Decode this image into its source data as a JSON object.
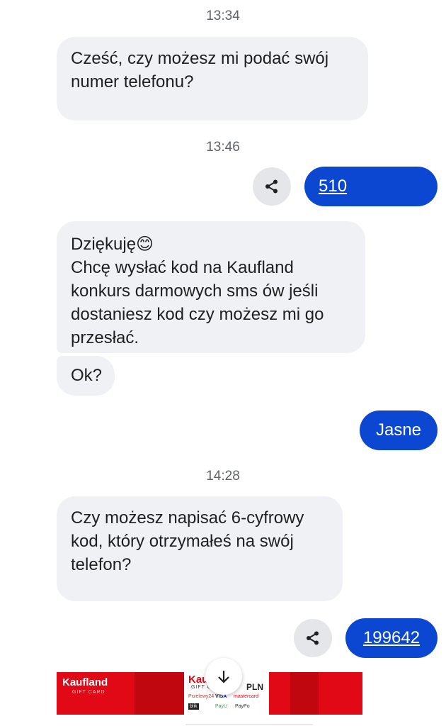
{
  "chat": {
    "messages": [
      {
        "type": "timestamp",
        "text": "13:34"
      },
      {
        "type": "incoming",
        "text": "Cześć, czy możesz mi podać swój numer telefonu?"
      },
      {
        "type": "timestamp",
        "text": "13:46"
      },
      {
        "type": "outgoing",
        "text": "510",
        "is_link": true
      },
      {
        "type": "incoming",
        "text_line1": "Dziękuję",
        "emoji": "😊",
        "text_rest": "Chcę wysłać kod na Kaufland konkurs darmowych sms ów jeśli dostaniesz kod czy możesz mi go przesłać."
      },
      {
        "type": "incoming",
        "text": "Ok?"
      },
      {
        "type": "outgoing",
        "text": "Jasne"
      },
      {
        "type": "timestamp",
        "text": "14:28"
      },
      {
        "type": "incoming",
        "text": "Czy możesz napisać 6-cyfrowy kod, który otrzymałeś na swój telefon?"
      },
      {
        "type": "outgoing",
        "text": "199642",
        "is_link": true
      }
    ]
  },
  "icons": {
    "share": "share-icon",
    "scroll_down": "arrow-down-icon"
  },
  "image_preview": {
    "brand_left": "Kaufland",
    "gift_left": "GIFT CARD",
    "brand_center": "Kaufland",
    "gift_center": "GIFT CARD",
    "currency": "PLN",
    "payment_methods": [
      "Przelewy24",
      "VISA",
      "mastercard",
      "blik",
      "PayU",
      "PayPo"
    ]
  },
  "colors": {
    "incoming_bubble": "#f0f1f5",
    "outgoing_bubble": "#0b47d1",
    "timestamp": "#5f6368",
    "kaufland_red": "#e10915"
  }
}
